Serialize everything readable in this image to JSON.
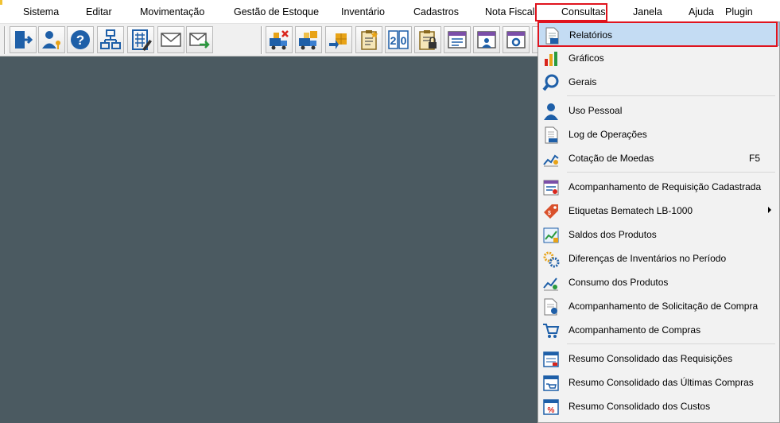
{
  "menubar": {
    "items": [
      "Sistema",
      "Editar",
      "Movimentação",
      "Gestão de Estoque",
      "Inventário",
      "Cadastros",
      "Nota Fiscal",
      "Consultas",
      "Janela",
      "Ajuda",
      "Plugin"
    ],
    "active": "Consultas"
  },
  "toolbar": {
    "buttons": [
      "exit-icon",
      "user-key-icon",
      "help-icon",
      "org-chart-icon",
      "calculator-icon",
      "envelope-icon",
      "envelope-send-icon",
      "truck-cancel-icon",
      "truck-boxes-icon",
      "box-transfer-icon",
      "clipboard-star-icon",
      "counter-20-icon",
      "clipboard-lock-icon",
      "form-icon",
      "form-user-icon",
      "form-config-icon"
    ]
  },
  "consultas_menu": {
    "items": [
      {
        "label": "Relatórios",
        "icon": "report-icon",
        "selected": true
      },
      {
        "label": "Gráficos",
        "icon": "bar-chart-icon"
      },
      {
        "label": "Gerais",
        "icon": "magnifier-icon"
      },
      {
        "label": "Uso Pessoal",
        "icon": "person-icon"
      },
      {
        "label": "Log de Operações",
        "icon": "log-document-icon"
      },
      {
        "label": "Cotação de Moedas",
        "icon": "trend-chart-icon",
        "shortcut": "F5"
      },
      {
        "label": "Acompanhamento de Requisição Cadastrada",
        "icon": "requisition-form-icon"
      },
      {
        "label": "Etiquetas Bematech LB-1000",
        "icon": "price-tag-icon",
        "submenu": true
      },
      {
        "label": "Saldos dos Produtos",
        "icon": "stock-chart-icon"
      },
      {
        "label": "Diferenças de Inventários no Período",
        "icon": "gears-icon"
      },
      {
        "label": "Consumo dos Produtos",
        "icon": "consumption-chart-icon"
      },
      {
        "label": "Acompanhamento de Solicitação de Compra",
        "icon": "purchase-request-icon"
      },
      {
        "label": "Acompanhamento de Compras",
        "icon": "shopping-cart-icon"
      },
      {
        "label": "Resumo Consolidado das Requisições",
        "icon": "summary-requisitions-icon"
      },
      {
        "label": "Resumo Consolidado das Últimas Compras",
        "icon": "summary-purchases-icon"
      },
      {
        "label": "Resumo Consolidado dos Custos",
        "icon": "summary-costs-icon"
      }
    ]
  },
  "colors": {
    "workspace": "#4b5a61",
    "highlight": "#e0141e",
    "selection": "#c4dcf3"
  }
}
